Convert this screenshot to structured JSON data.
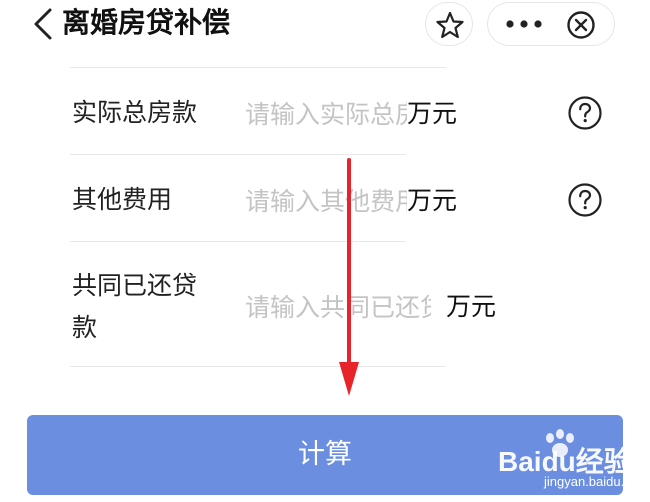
{
  "header": {
    "title": "离婚房贷补偿",
    "icons": [
      "chevron-left-icon",
      "star-icon",
      "more-icon",
      "close-circle-icon"
    ]
  },
  "fields": [
    {
      "label": "实际总房款",
      "placeholder": "请输入实际总房款",
      "value": "",
      "unit": "万元"
    },
    {
      "label": "其他费用",
      "placeholder": "请输入其他费用",
      "value": "",
      "unit": "万元"
    },
    {
      "label_line1": "共同已还贷",
      "label_line2": "款",
      "placeholder": "请输入共同已还贷款",
      "value": "",
      "unit": "万元"
    }
  ],
  "calculate_label": "计算",
  "watermark": {
    "brand": "Baidu经验",
    "url": "jingyan.baidu.com"
  },
  "colors": {
    "button": "#6b8ee0",
    "arrow": "#e8232a"
  }
}
